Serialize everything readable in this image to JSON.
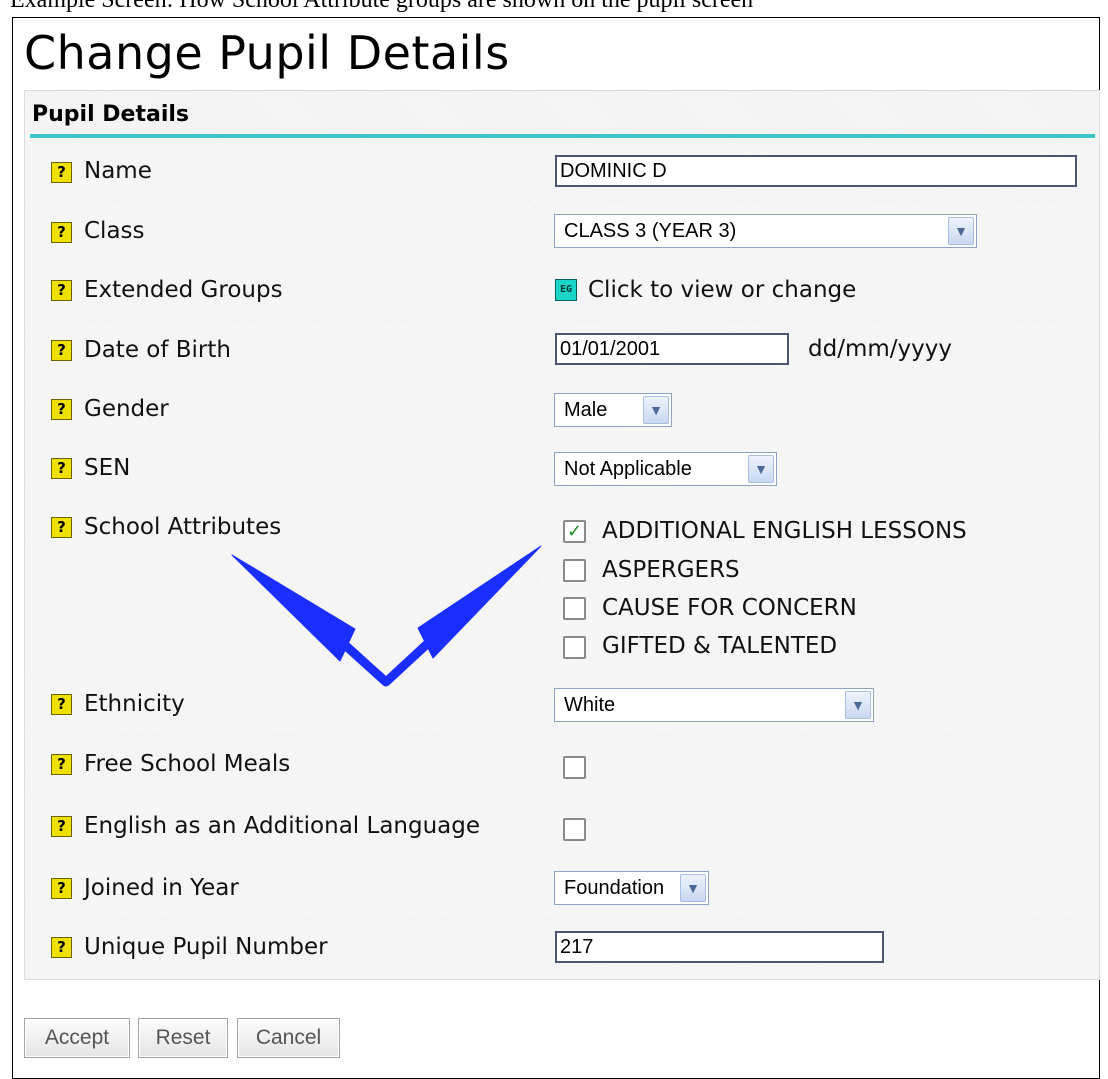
{
  "caption": "Example Screen:  How School Attribute groups are shown on the pupil screen",
  "page_title": "Change Pupil Details",
  "section_heading": "Pupil Details",
  "help_glyph": "?",
  "fields": {
    "name": {
      "label": "Name",
      "value": "DOMINIC D"
    },
    "class": {
      "label": "Class",
      "selected": "CLASS 3 (YEAR 3)"
    },
    "extended_groups": {
      "label": "Extended Groups",
      "icon_text": "EG",
      "link_text": "Click to view or change"
    },
    "dob": {
      "label": "Date of Birth",
      "value": "01/01/2001",
      "hint": "dd/mm/yyyy"
    },
    "gender": {
      "label": "Gender",
      "selected": "Male"
    },
    "sen": {
      "label": "SEN",
      "selected": "Not Applicable"
    },
    "school_attributes": {
      "label": "School Attributes",
      "options": [
        {
          "label": "ADDITIONAL ENGLISH LESSONS",
          "checked": true
        },
        {
          "label": "ASPERGERS",
          "checked": false
        },
        {
          "label": "CAUSE FOR CONCERN",
          "checked": false
        },
        {
          "label": "GIFTED & TALENTED",
          "checked": false
        }
      ]
    },
    "ethnicity": {
      "label": "Ethnicity",
      "selected": "White"
    },
    "free_school_meals": {
      "label": "Free School Meals",
      "checked": false
    },
    "eal": {
      "label": "English as an Additional Language",
      "checked": false
    },
    "joined_in_year": {
      "label": "Joined in Year",
      "selected": "Foundation"
    },
    "upn": {
      "label": "Unique Pupil Number",
      "value": "217"
    }
  },
  "buttons": {
    "accept": "Accept",
    "reset": "Reset",
    "cancel": "Cancel"
  },
  "colors": {
    "section_rule": "#3cc6c6",
    "help_icon": "#f0e000",
    "annotation_arrow": "#1a2fff"
  }
}
